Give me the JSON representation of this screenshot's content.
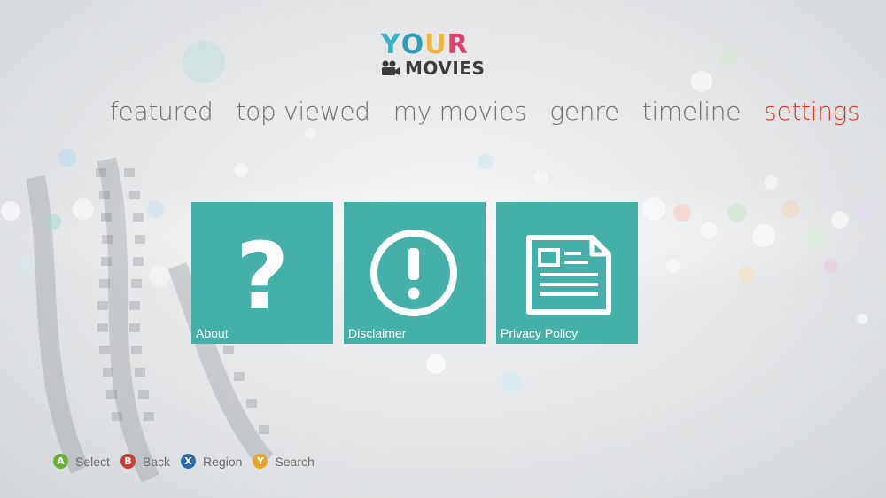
{
  "logo": {
    "top_letters": [
      {
        "char": "Y",
        "color": "#3ab0c6"
      },
      {
        "char": "O",
        "color": "#2e9fb5"
      },
      {
        "char": "U",
        "color": "#f1b53d"
      },
      {
        "char": "R",
        "color": "#e0406b"
      }
    ],
    "word": "MOVIES"
  },
  "nav": {
    "items": [
      {
        "label": "featured",
        "active": false
      },
      {
        "label": "top viewed",
        "active": false
      },
      {
        "label": "my movies",
        "active": false
      },
      {
        "label": "genre",
        "active": false
      },
      {
        "label": "timeline",
        "active": false
      },
      {
        "label": "settings",
        "active": true
      }
    ]
  },
  "tiles": [
    {
      "label": "About",
      "icon": "question-mark-icon"
    },
    {
      "label": "Disclaimer",
      "icon": "exclamation-icon"
    },
    {
      "label": "Privacy Policy",
      "icon": "document-icon"
    }
  ],
  "footer": {
    "hints": [
      {
        "button": "A",
        "label": "Select",
        "color": "#6aae3c"
      },
      {
        "button": "B",
        "label": "Back",
        "color": "#c8403a"
      },
      {
        "button": "X",
        "label": "Region",
        "color": "#2e6aa8"
      },
      {
        "button": "Y",
        "label": "Search",
        "color": "#e2a72a"
      }
    ]
  },
  "colors": {
    "tile": "#45b0a8",
    "active_nav": "#d63a2c",
    "nav": "#6f6f6f"
  }
}
